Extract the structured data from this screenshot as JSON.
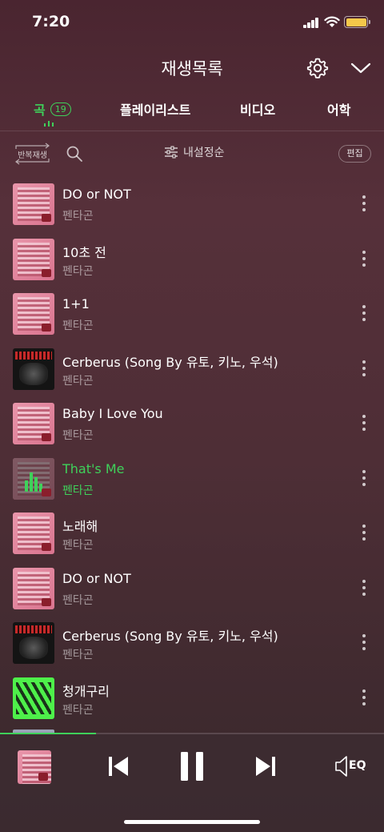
{
  "status_bar": {
    "time": "7:20"
  },
  "header": {
    "title": "재생목록",
    "settings_icon": "gear-icon",
    "collapse_icon": "chevron-down-icon"
  },
  "tabs": [
    {
      "label": "곡",
      "count": "19",
      "active": true
    },
    {
      "label": "플레이리스트",
      "active": false
    },
    {
      "label": "비디오",
      "active": false
    },
    {
      "label": "어학",
      "active": false
    }
  ],
  "toolbar": {
    "repeat_label": "반복재생",
    "sort_label": "내설정순",
    "edit_label": "편집"
  },
  "tracks": [
    {
      "title": "DO or NOT",
      "artist": "펜타곤",
      "art": "pink",
      "playing": false
    },
    {
      "title": "10초 전",
      "artist": "펜타곤",
      "art": "pink",
      "playing": false
    },
    {
      "title": "1+1",
      "artist": "펜타곤",
      "art": "pink",
      "playing": false
    },
    {
      "title": "Cerberus (Song By 유토, 키노, 우석)",
      "artist": "펜타곤",
      "art": "dark",
      "playing": false
    },
    {
      "title": "Baby I Love You",
      "artist": "펜타곤",
      "art": "pink",
      "playing": false
    },
    {
      "title": "That's Me",
      "artist": "펜타곤",
      "art": "pink",
      "playing": true
    },
    {
      "title": "노래해",
      "artist": "펜타곤",
      "art": "pink",
      "playing": false
    },
    {
      "title": "DO or NOT",
      "artist": "펜타곤",
      "art": "pink",
      "playing": false
    },
    {
      "title": "Cerberus (Song By 유토, 키노, 우석)",
      "artist": "펜타곤",
      "art": "dark",
      "playing": false
    },
    {
      "title": "청개구리",
      "artist": "펜타곤",
      "art": "green",
      "playing": false
    }
  ],
  "player": {
    "progress": 0.25,
    "eq_label": "EQ"
  },
  "colors": {
    "accent": "#3fd15a",
    "text": "#ffffff",
    "muted": "rgba(255,255,255,0.5)"
  }
}
